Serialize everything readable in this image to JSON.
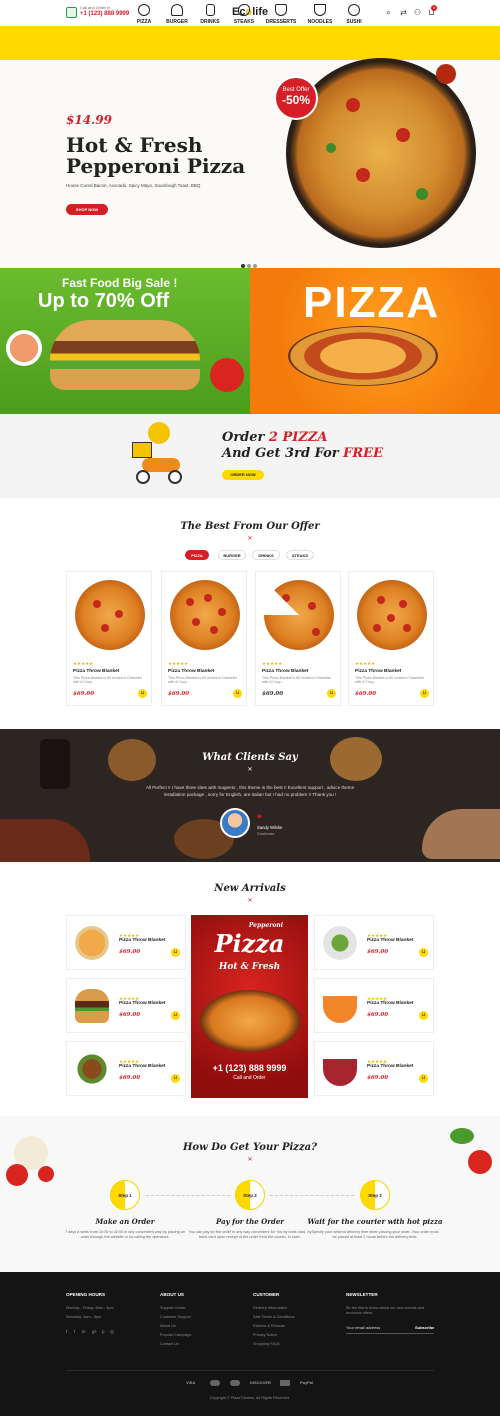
{
  "header": {
    "phone_label": "Call and Order in",
    "phone_number": "+1 (123) 888 9999",
    "logo_main": "Ec",
    "logo_o": "o",
    "logo_rest": "life",
    "icons": [
      "search-icon",
      "shuffle-icon",
      "user-icon",
      "cart-icon"
    ],
    "cart_count": "0"
  },
  "nav": {
    "items": [
      {
        "label": "PIZZA"
      },
      {
        "label": "BURGER"
      },
      {
        "label": "DRINKS"
      },
      {
        "label": "STEAKS"
      },
      {
        "label": "DRESSERTS"
      },
      {
        "label": "NOODLES"
      },
      {
        "label": "SUSHI"
      }
    ]
  },
  "hero": {
    "price": "$14.99",
    "title_line1": "Hot & Fresh",
    "title_line2": "Pepperoni Pizza",
    "subtitle": "House Cured Bacon, Avocado, Spicy Mayo, Sourdough Toast, BBQ",
    "button": "SHOP NOW",
    "offer_label": "Best Offer",
    "offer_value": "-50%"
  },
  "banners": {
    "sale_title": "Fast Food Big Sale !",
    "sale_value": "Up to 70% Off",
    "pizza_word": "PIZZA"
  },
  "order_promo": {
    "line1_a": "Order ",
    "line1_b": "2 PIZZA",
    "line2_a": "And Get 3rd For ",
    "line2_b": "FREE",
    "button": "ORDER NOW"
  },
  "offer": {
    "title": "The Best From Our Offer",
    "tabs": [
      "PIZZA",
      "BURGER",
      "DRINKS",
      "STEAKS"
    ],
    "products": [
      {
        "stars": "★★★★★",
        "name": "Pizza Throw Blanket",
        "desc": "This Pizza Blanket is 60 inches in Diameter with A Cozy...",
        "price": "$69.00"
      },
      {
        "stars": "★★★★★",
        "name": "Pizza Throw Blanket",
        "desc": "This Pizza Blanket is 60 inches in Diameter with A Cozy...",
        "price": "$69.00"
      },
      {
        "stars": "★★★★★",
        "name": "Pizza Throw Blanket",
        "desc": "This Pizza Blanket is 60 inches in Diameter with A Cozy...",
        "price": "$69.00"
      },
      {
        "stars": "★★★★★",
        "name": "Pizza Throw Blanket",
        "desc": "This Pizza Blanket is 60 inches in Diameter with A Cozy...",
        "price": "$69.00"
      }
    ]
  },
  "testimonial": {
    "title": "What Clients Say",
    "text": "All Perfect !! I have three sites with magento , this theme is the best !! Excellent support , advice theme installation package , sorry for English, are Italian but I had no problem !! Thank you !",
    "name": "Sandy Wilcke",
    "role": "Customer"
  },
  "arrivals": {
    "title": "New Arrivals",
    "left": [
      {
        "stars": "★★★★★",
        "name": "Pizza Throw Blanket",
        "price": "$69.00"
      },
      {
        "stars": "★★★★★",
        "name": "Pizza Throw Blanket",
        "price": "$69.00"
      },
      {
        "stars": "★★★★★",
        "name": "Pizza Throw Blanket",
        "price": "$69.00"
      }
    ],
    "right": [
      {
        "stars": "★★★★★",
        "name": "Pizza Throw Blanket",
        "price": "$69.00"
      },
      {
        "stars": "★★★★★",
        "name": "Pizza Throw Blanket",
        "price": "$69.00"
      },
      {
        "stars": "★★★★★",
        "name": "Pizza Throw Blanket",
        "price": "$69.00"
      }
    ],
    "promo": {
      "pepperoni": "Pepperoni",
      "pizza": "Pizza",
      "hot_fresh": "Hot & Fresh",
      "phone": "+1 (123) 888 9999",
      "call": "Call and Order"
    }
  },
  "how": {
    "title": "How Do Get Your Pizza?",
    "steps": [
      {
        "label": "Step 1",
        "title": "Make an Order",
        "desc": "7 days a week from 10:00 to 22:00 in any convenient way by placing an order through the website or by calling the operators."
      },
      {
        "label": "Step 2",
        "title": "Pay for the Order",
        "desc": "You can pay for the order in any way convenient for You by bank card, by bank card upon receipt of the order from the courier, in cash."
      },
      {
        "label": "Step 3",
        "title": "Wait for the courier with hot pizza",
        "desc": "Specify your desired delivery time when placing your order. Your order must be placed at least 2 hours before the delivery time."
      }
    ]
  },
  "footer": {
    "hours_title": "OPENING HOURS",
    "hours": [
      "Monday - Friday: 8am - 4pm",
      "Saturday: 9am - 5pm"
    ],
    "about_title": "ABOUT US",
    "about": [
      "Support Center",
      "Customer Support",
      "About Us",
      "Popular Campaign",
      "Contact Us"
    ],
    "customer_title": "CUSTOMER",
    "customer": [
      "Delivery Information",
      "Sale Terms & Conditions",
      "Returns & Refunds",
      "Privacy Notice",
      "Shopping FAQs"
    ],
    "newsletter_title": "NEWSLETTER",
    "newsletter_text": "Be the first to know about our new arrivals and exclusive offers.",
    "email_placeholder": "Your email address",
    "subscribe": "Subscribe",
    "payments": [
      "VISA",
      "DISCOVER",
      "PayPal"
    ],
    "copyright": "Copyright © PlazaThemes. All Rights Reserved."
  },
  "colors": {
    "accent": "#ffd900",
    "brand_red": "#d51e25",
    "footer_bg": "#141414"
  }
}
